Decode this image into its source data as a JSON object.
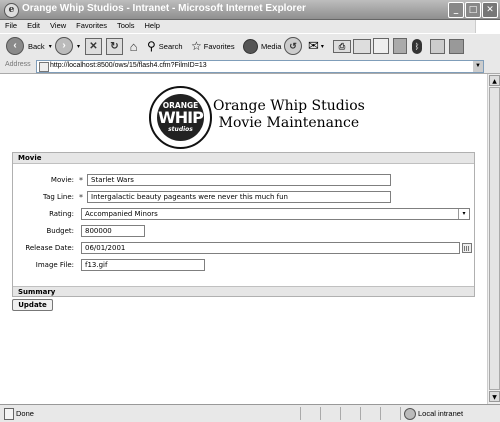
{
  "window": {
    "title": "Orange Whip Studios - Intranet - Microsoft Internet Explorer",
    "minimize": "_",
    "maximize": "□",
    "close": "✕"
  },
  "menu": [
    "File",
    "Edit",
    "View",
    "Favorites",
    "Tools",
    "Help"
  ],
  "toolbar": {
    "back_label": "Back",
    "search_label": "Search",
    "favorites_label": "Favorites",
    "media_label": "Media"
  },
  "address": {
    "label": "Address",
    "url": "http://localhost:8500/ows/15/flash4.cfm?FilmID=13"
  },
  "logo": {
    "line1": "ORANGE",
    "line2": "WHIP",
    "line3": "studios"
  },
  "page": {
    "heading_line1": "Orange Whip Studios",
    "heading_line2": "Movie Maintenance"
  },
  "form": {
    "section_title": "Movie",
    "summary_title": "Summary",
    "required_marker": "*",
    "fields": {
      "movie": {
        "label": "Movie:",
        "value": "Starlet Wars"
      },
      "tagline": {
        "label": "Tag Line:",
        "value": "Intergalactic beauty pageants were never this much fun"
      },
      "rating": {
        "label": "Rating:",
        "value": "Accompanied Minors"
      },
      "budget": {
        "label": "Budget:",
        "value": "800000"
      },
      "release_date": {
        "label": "Release Date:",
        "value": "06/01/2001"
      },
      "image_file": {
        "label": "Image File:",
        "value": "f13.gif"
      }
    },
    "update_label": "Update"
  },
  "status": {
    "text": "Done",
    "zone": "Local intranet"
  },
  "icons": {
    "ie": "internet-explorer-icon",
    "back": "back-arrow-icon",
    "forward": "forward-arrow-icon",
    "stop": "stop-icon",
    "refresh": "refresh-icon",
    "home": "home-icon",
    "search": "search-icon",
    "favorites": "star-icon",
    "media": "media-icon",
    "history": "history-icon",
    "mail": "mail-icon",
    "print": "print-icon",
    "calendar": "calendar-icon"
  }
}
